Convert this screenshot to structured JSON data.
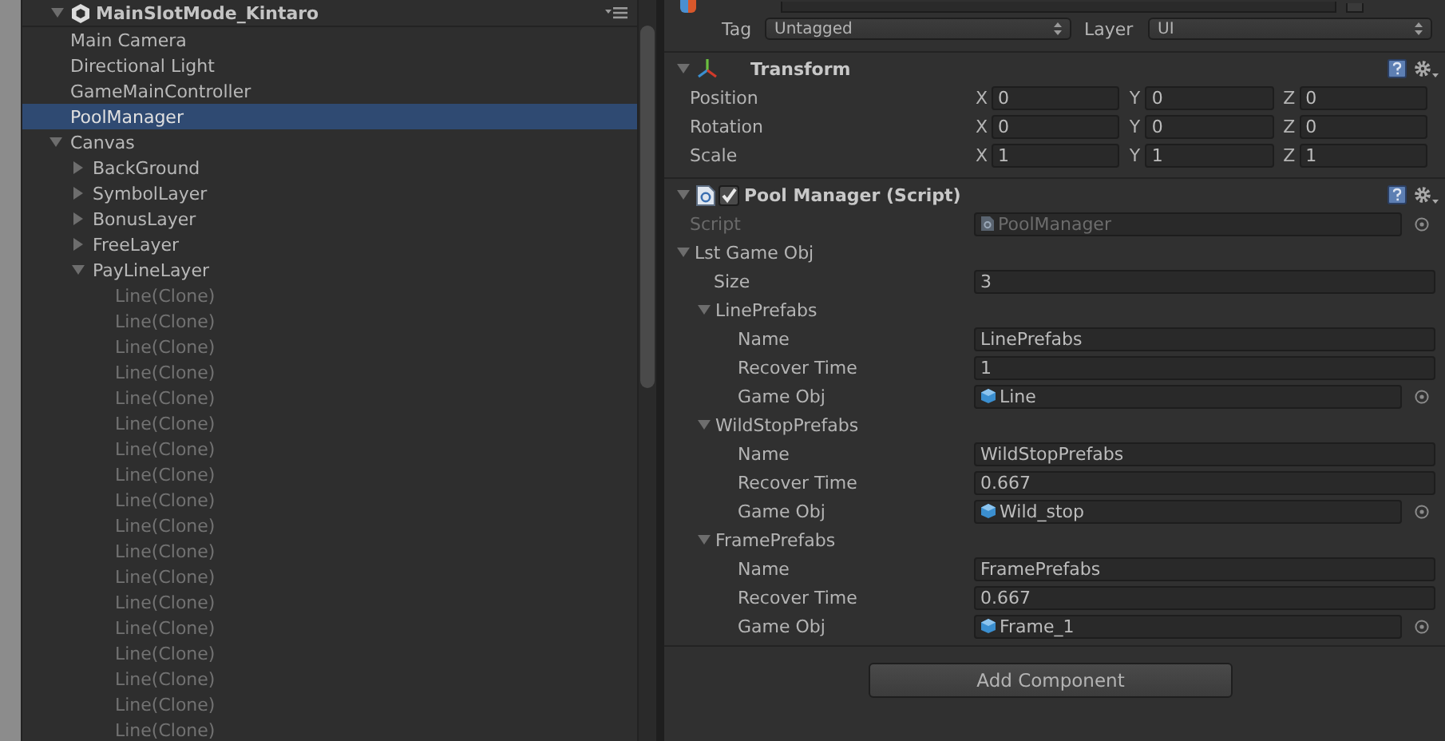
{
  "hierarchy": {
    "scene": "MainSlotMode_Kintaro",
    "expanded": true,
    "items": [
      {
        "label": "Main Camera",
        "selected": false,
        "active": true
      },
      {
        "label": "Directional Light",
        "selected": false,
        "active": true
      },
      {
        "label": "GameMainController",
        "selected": false,
        "active": true
      },
      {
        "label": "PoolManager",
        "selected": true,
        "active": true
      },
      {
        "label": "Canvas",
        "selected": false,
        "active": true,
        "expanded": true,
        "children": [
          {
            "label": "BackGround",
            "selected": false,
            "active": true,
            "expanded": false
          },
          {
            "label": "SymbolLayer",
            "selected": false,
            "active": true,
            "expanded": false
          },
          {
            "label": "BonusLayer",
            "selected": false,
            "active": true,
            "expanded": false
          },
          {
            "label": "FreeLayer",
            "selected": false,
            "active": true,
            "expanded": false
          },
          {
            "label": "PayLineLayer",
            "selected": false,
            "active": true,
            "expanded": true,
            "children": [
              {
                "label": "Line(Clone)",
                "selected": false,
                "active": false
              },
              {
                "label": "Line(Clone)",
                "selected": false,
                "active": false
              },
              {
                "label": "Line(Clone)",
                "selected": false,
                "active": false
              },
              {
                "label": "Line(Clone)",
                "selected": false,
                "active": false
              },
              {
                "label": "Line(Clone)",
                "selected": false,
                "active": false
              },
              {
                "label": "Line(Clone)",
                "selected": false,
                "active": false
              },
              {
                "label": "Line(Clone)",
                "selected": false,
                "active": false
              },
              {
                "label": "Line(Clone)",
                "selected": false,
                "active": false
              },
              {
                "label": "Line(Clone)",
                "selected": false,
                "active": false
              },
              {
                "label": "Line(Clone)",
                "selected": false,
                "active": false
              },
              {
                "label": "Line(Clone)",
                "selected": false,
                "active": false
              },
              {
                "label": "Line(Clone)",
                "selected": false,
                "active": false
              },
              {
                "label": "Line(Clone)",
                "selected": false,
                "active": false
              },
              {
                "label": "Line(Clone)",
                "selected": false,
                "active": false
              },
              {
                "label": "Line(Clone)",
                "selected": false,
                "active": false
              },
              {
                "label": "Line(Clone)",
                "selected": false,
                "active": false
              },
              {
                "label": "Line(Clone)",
                "selected": false,
                "active": false
              },
              {
                "label": "Line(Clone)",
                "selected": false,
                "active": false
              }
            ]
          }
        ]
      }
    ]
  },
  "inspector": {
    "static_checked": false,
    "tag": {
      "label": "Tag",
      "value": "Untagged"
    },
    "layer": {
      "label": "Layer",
      "value": "UI"
    },
    "transform": {
      "title": "Transform",
      "expanded": true,
      "rows": [
        {
          "label": "Position",
          "axes": [
            {
              "axis": "X",
              "value": "0"
            },
            {
              "axis": "Y",
              "value": "0"
            },
            {
              "axis": "Z",
              "value": "0"
            }
          ]
        },
        {
          "label": "Rotation",
          "axes": [
            {
              "axis": "X",
              "value": "0"
            },
            {
              "axis": "Y",
              "value": "0"
            },
            {
              "axis": "Z",
              "value": "0"
            }
          ]
        },
        {
          "label": "Scale",
          "axes": [
            {
              "axis": "X",
              "value": "1"
            },
            {
              "axis": "Y",
              "value": "1"
            },
            {
              "axis": "Z",
              "value": "1"
            }
          ]
        }
      ]
    },
    "script_component": {
      "title": "Pool Manager (Script)",
      "enabled": true,
      "expanded": true,
      "script": {
        "label": "Script",
        "value": "PoolManager",
        "disabled": true
      },
      "list": {
        "label": "Lst Game Obj",
        "expanded": true,
        "size": {
          "label": "Size",
          "value": "3"
        },
        "elements": [
          {
            "title": "LinePrefabs",
            "expanded": true,
            "fields": [
              {
                "label": "Name",
                "value": "LinePrefabs",
                "kind": "text"
              },
              {
                "label": "Recover Time",
                "value": "1",
                "kind": "text"
              },
              {
                "label": "Game Obj",
                "value": "Line",
                "kind": "object"
              }
            ]
          },
          {
            "title": "WildStopPrefabs",
            "expanded": true,
            "fields": [
              {
                "label": "Name",
                "value": "WildStopPrefabs",
                "kind": "text"
              },
              {
                "label": "Recover Time",
                "value": "0.667",
                "kind": "text"
              },
              {
                "label": "Game Obj",
                "value": "Wild_stop",
                "kind": "object"
              }
            ]
          },
          {
            "title": "FramePrefabs",
            "expanded": true,
            "fields": [
              {
                "label": "Name",
                "value": "FramePrefabs",
                "kind": "text"
              },
              {
                "label": "Recover Time",
                "value": "0.667",
                "kind": "text"
              },
              {
                "label": "Game Obj",
                "value": "Frame_1",
                "kind": "object"
              }
            ]
          }
        ]
      }
    },
    "add_component": "Add Component"
  }
}
